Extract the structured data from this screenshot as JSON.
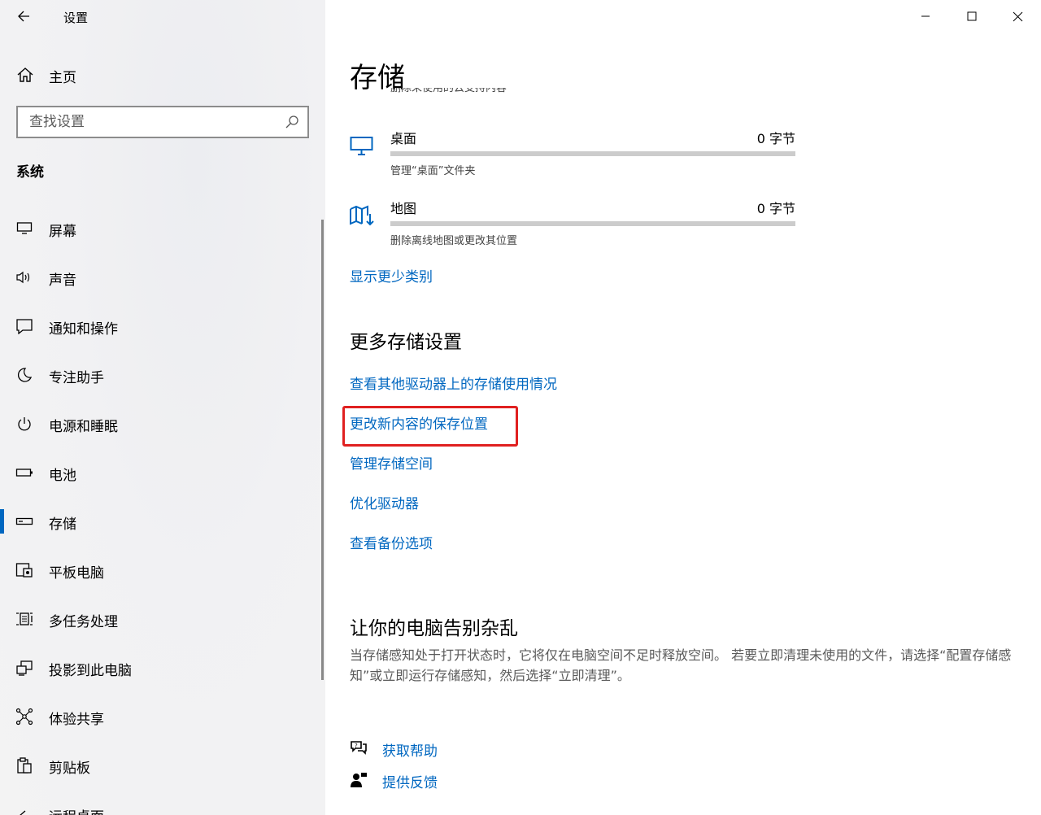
{
  "window": {
    "app_title": "设置"
  },
  "sidebar": {
    "home_label": "主页",
    "search_placeholder": "查找设置",
    "section_title": "系统",
    "items": [
      {
        "label": "屏幕",
        "icon": "monitor-icon"
      },
      {
        "label": "声音",
        "icon": "speaker-icon"
      },
      {
        "label": "通知和操作",
        "icon": "notification-icon"
      },
      {
        "label": "专注助手",
        "icon": "moon-icon"
      },
      {
        "label": "电源和睡眠",
        "icon": "power-icon"
      },
      {
        "label": "电池",
        "icon": "battery-icon"
      },
      {
        "label": "存储",
        "icon": "storage-icon",
        "active": true
      },
      {
        "label": "平板电脑",
        "icon": "tablet-icon"
      },
      {
        "label": "多任务处理",
        "icon": "multitask-icon"
      },
      {
        "label": "投影到此电脑",
        "icon": "project-icon"
      },
      {
        "label": "体验共享",
        "icon": "share-icon"
      },
      {
        "label": "剪贴板",
        "icon": "clipboard-icon"
      },
      {
        "label": "远程桌面",
        "icon": "remote-desktop-icon"
      }
    ]
  },
  "main": {
    "title": "存储",
    "clipped_text": "删除未使用的云支持内容",
    "categories": [
      {
        "name": "桌面",
        "size": "0 字节",
        "desc": "管理“桌面”文件夹",
        "icon": "desktop-icon",
        "fill": 0
      },
      {
        "name": "地图",
        "size": "0 字节",
        "desc": "删除离线地图或更改其位置",
        "icon": "map-icon",
        "fill": 0
      }
    ],
    "show_fewer_link": "显示更少类别",
    "more_settings": {
      "title": "更多存储设置",
      "links": [
        "查看其他驱动器上的存储使用情况",
        "更改新内容的保存位置",
        "管理存储空间",
        "优化驱动器",
        "查看备份选项"
      ]
    },
    "declutter": {
      "title": "让你的电脑告别杂乱",
      "text": "当存储感知处于打开状态时，它将仅在电脑空间不足时释放空间。 若要立即清理未使用的文件，请选择“配置存储感知”或立即运行存储感知，然后选择“立即清理”。"
    },
    "help": {
      "get_help": "获取帮助",
      "feedback": "提供反馈"
    }
  },
  "colors": {
    "accent": "#0067c0",
    "highlight": "#e02020"
  }
}
